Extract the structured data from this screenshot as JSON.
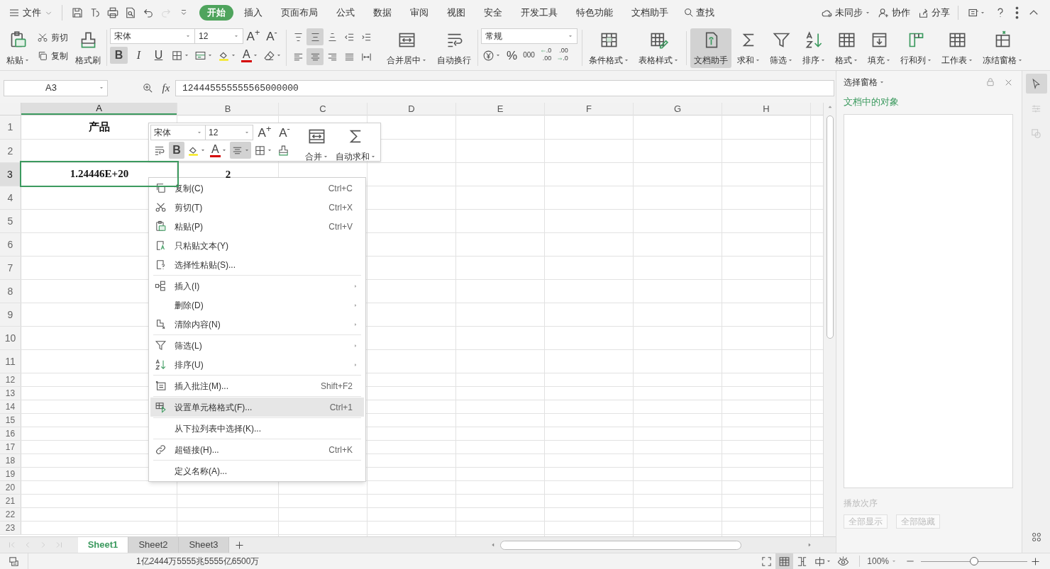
{
  "menu_bar": {
    "file": "文件",
    "tabs": [
      {
        "label": "开始",
        "selected": true
      },
      {
        "label": "插入",
        "selected": false
      },
      {
        "label": "页面布局",
        "selected": false
      },
      {
        "label": "公式",
        "selected": false
      },
      {
        "label": "数据",
        "selected": false
      },
      {
        "label": "审阅",
        "selected": false
      },
      {
        "label": "视图",
        "selected": false
      },
      {
        "label": "安全",
        "selected": false
      },
      {
        "label": "开发工具",
        "selected": false
      },
      {
        "label": "特色功能",
        "selected": false
      },
      {
        "label": "文档助手",
        "selected": false
      }
    ],
    "search": "查找",
    "account": [
      {
        "label": "未同步",
        "dropdown": true
      },
      {
        "label": "协作",
        "dropdown": false
      },
      {
        "label": "分享",
        "dropdown": false
      }
    ]
  },
  "quick_access": [
    {
      "disabled": false
    },
    {
      "disabled": false
    },
    {
      "disabled": false
    },
    {
      "disabled": false
    },
    {
      "disabled": false
    },
    {
      "disabled": true
    },
    {
      "disabled": false
    }
  ],
  "ribbon": {
    "clipboard": [
      {
        "label": "粘贴",
        "dropdown": true
      },
      {
        "label": "剪切",
        "dropdown": false
      },
      {
        "label": "复制",
        "dropdown": false
      },
      {
        "label": "格式刷",
        "dropdown": false
      }
    ],
    "font": {
      "name": "宋体",
      "size": "12",
      "grow": "A$^{+}$",
      "shrink": "A$^{-}$",
      "styles": [
        {
          "glyph": "B",
          "pressed": true
        },
        {
          "glyph": "I",
          "pressed": false
        },
        {
          "glyph": "U",
          "pressed": false
        }
      ],
      "color_glyph": "A"
    },
    "alignment": {
      "vertical": [
        {
          "pressed": false
        },
        {
          "pressed": true
        },
        {
          "pressed": false
        }
      ],
      "horizontal": [
        {
          "pressed": false
        },
        {
          "pressed": true
        },
        {
          "pressed": false
        },
        {
          "pressed": false
        },
        {
          "pressed": false
        }
      ]
    },
    "wrap_merge": [
      {
        "label": "合并居中",
        "dropdown": true
      },
      {
        "label": "自动换行",
        "dropdown": false
      }
    ],
    "number": {
      "format": "常规",
      "percent": "%",
      "thousands": "000",
      "decimals": [
        {
          "top": ".0",
          "bottom": ".00"
        },
        {
          "top": ".00",
          "bottom": ".0"
        }
      ]
    },
    "tools": [
      {
        "label": "条件格式",
        "dropdown": true,
        "pressed": false
      },
      {
        "label": "表格样式",
        "dropdown": true,
        "pressed": false
      },
      {
        "label": "文档助手",
        "dropdown": false,
        "pressed": true
      },
      {
        "label": "求和",
        "dropdown": true,
        "pressed": false
      },
      {
        "label": "筛选",
        "dropdown": true,
        "pressed": false
      },
      {
        "label": "排序",
        "dropdown": true,
        "pressed": false
      },
      {
        "label": "格式",
        "dropdown": true,
        "pressed": false
      },
      {
        "label": "填充",
        "dropdown": true,
        "pressed": false
      },
      {
        "label": "行和列",
        "dropdown": true,
        "pressed": false
      },
      {
        "label": "工作表",
        "dropdown": true,
        "pressed": false
      },
      {
        "label": "冻结窗格",
        "dropdown": true,
        "pressed": false
      }
    ]
  },
  "formula_bar": {
    "cell": "A3",
    "fx": "fx",
    "value": "124445555555565000000"
  },
  "sheet": {
    "columns": [
      {
        "label": "A",
        "selected": true
      },
      {
        "label": "B",
        "selected": false
      },
      {
        "label": "C",
        "selected": false
      },
      {
        "label": "D",
        "selected": false
      },
      {
        "label": "E",
        "selected": false
      },
      {
        "label": "F",
        "selected": false
      },
      {
        "label": "G",
        "selected": false
      },
      {
        "label": "H",
        "selected": false
      }
    ],
    "rows": [
      {
        "label": "1",
        "selected": false,
        "column_a": "产品"
      },
      {
        "label": "2",
        "selected": false
      },
      {
        "label": "3",
        "selected": true,
        "column_a": "1.24446E+20",
        "column_b": "2"
      },
      {
        "label": "4",
        "selected": false
      },
      {
        "label": "5",
        "selected": false
      },
      {
        "label": "6",
        "selected": false
      },
      {
        "label": "7",
        "selected": false
      },
      {
        "label": "8",
        "selected": false
      },
      {
        "label": "9",
        "selected": false
      },
      {
        "label": "10",
        "selected": false
      },
      {
        "label": "11",
        "selected": false
      },
      {
        "label": "12",
        "selected": false
      },
      {
        "label": "13",
        "selected": false
      },
      {
        "label": "14",
        "selected": false
      },
      {
        "label": "15",
        "selected": false
      },
      {
        "label": "16",
        "selected": false
      },
      {
        "label": "17",
        "selected": false
      },
      {
        "label": "18",
        "selected": false
      },
      {
        "label": "19",
        "selected": false
      },
      {
        "label": "20",
        "selected": false
      },
      {
        "label": "21",
        "selected": false
      },
      {
        "label": "22",
        "selected": false
      },
      {
        "label": "23",
        "selected": false
      }
    ]
  },
  "mini_toolbar": {
    "font": "宋体",
    "size": "12",
    "grow": "A$^{+}$",
    "shrink": "A$^{-}$",
    "bold": {
      "glyph": "B",
      "pressed": true
    },
    "color_glyph": "A",
    "align_center_pressed": true,
    "buttons": [
      {
        "label": "合并",
        "dropdown": true
      },
      {
        "label": "自动求和",
        "dropdown": true
      }
    ]
  },
  "context_menu": {
    "groups": [
      [
        {
          "label": "复制(C)",
          "shortcut": "Ctrl+C",
          "submenu": false,
          "selected": false
        },
        {
          "label": "剪切(T)",
          "shortcut": "Ctrl+X",
          "submenu": false,
          "selected": false
        },
        {
          "label": "粘贴(P)",
          "shortcut": "Ctrl+V",
          "submenu": false,
          "selected": false
        },
        {
          "label": "只粘贴文本(Y)",
          "submenu": false,
          "selected": false
        },
        {
          "label": "选择性粘贴(S)...",
          "submenu": false,
          "selected": false
        }
      ],
      [
        {
          "label": "插入(I)",
          "submenu": true,
          "selected": false
        },
        {
          "label": "删除(D)",
          "submenu": true,
          "selected": false
        },
        {
          "label": "清除内容(N)",
          "submenu": true,
          "selected": false
        }
      ],
      [
        {
          "label": "筛选(L)",
          "submenu": true,
          "selected": false
        },
        {
          "label": "排序(U)",
          "submenu": true,
          "selected": false
        }
      ],
      [
        {
          "label": "插入批注(M)...",
          "shortcut": "Shift+F2",
          "submenu": false,
          "selected": false
        }
      ],
      [
        {
          "label": "设置单元格格式(F)...",
          "shortcut": "Ctrl+1",
          "submenu": false,
          "selected": true
        }
      ],
      [
        {
          "label": "从下拉列表中选择(K)...",
          "submenu": false,
          "selected": false
        }
      ],
      [
        {
          "label": "超链接(H)...",
          "shortcut": "Ctrl+K",
          "submenu": false,
          "selected": false
        }
      ],
      [
        {
          "label": "定义名称(A)...",
          "submenu": false,
          "selected": false
        }
      ]
    ]
  },
  "selection_pane": {
    "title": "选择窗格",
    "heading": "文档中的对象",
    "order_label": "播放次序",
    "buttons": [
      {
        "label": "全部显示",
        "disabled": true
      },
      {
        "label": "全部隐藏",
        "disabled": true
      }
    ]
  },
  "side_tools": [
    {
      "selected": true
    },
    {
      "selected": false
    },
    {
      "selected": false
    }
  ],
  "sheet_tabs": [
    {
      "label": "Sheet1",
      "selected": true
    },
    {
      "label": "Sheet2",
      "selected": false
    },
    {
      "label": "Sheet3",
      "selected": false
    }
  ],
  "status_bar": {
    "text": "1亿2444万5555兆5555亿6500万",
    "views": [
      {
        "selected": false
      },
      {
        "selected": true
      },
      {
        "selected": false
      },
      {
        "selected": false
      },
      {
        "selected": false
      }
    ],
    "zoom": "100%",
    "zoom_slider": {
      "level": 0.5
    }
  }
}
